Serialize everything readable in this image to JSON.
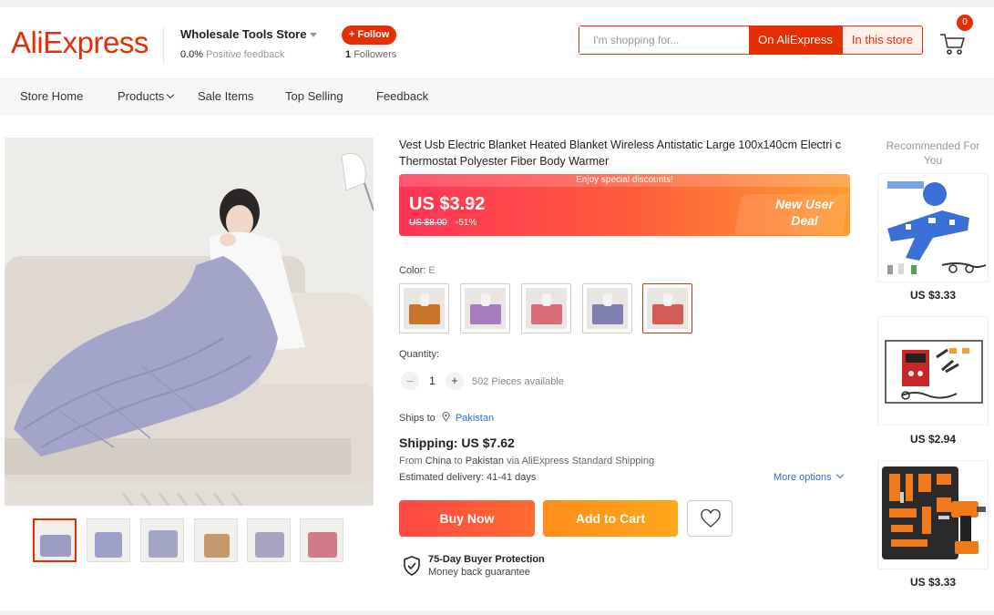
{
  "brand": {
    "logo_text": "AliExpress",
    "accent": "#e62e04"
  },
  "store": {
    "name": "Wholesale Tools Store",
    "feedback_value": "0.0%",
    "feedback_label": "Positive feedback",
    "follow_label": "+ Follow",
    "followers_count": "1",
    "followers_label": "Followers"
  },
  "search": {
    "placeholder": "I'm shopping for...",
    "btn_aliexpress": "On AliExpress",
    "btn_store": "In this store"
  },
  "cart": {
    "count": "0",
    "icon": "cart-icon"
  },
  "nav": {
    "items": [
      {
        "label": "Store Home"
      },
      {
        "label": "Products",
        "dropdown": true
      },
      {
        "label": "Sale Items"
      },
      {
        "label": "Top Selling"
      },
      {
        "label": "Feedback"
      }
    ]
  },
  "product": {
    "title": "Vest Usb Electric Blanket Heated Blanket Wireless Antistatic Large 100x140cm Electri c Thermostat Polyester Fiber Body Warmer",
    "banner_top": "Enjoy special discounts!",
    "price": "US $3.92",
    "original_price": "US $8.00",
    "discount": "-51%",
    "deal_line1": "New User",
    "deal_line2": "Deal",
    "color_label": "Color:",
    "color_value": "E",
    "quantity_label": "Quantity:",
    "quantity": "1",
    "qty_minus": "–",
    "qty_plus": "+",
    "available": "502 Pieces available",
    "ships_to_label": "Ships to",
    "ships_to_country": "Pakistan",
    "shipping": "Shipping: US $7.62",
    "ship_from_pre": "From",
    "ship_from_origin": "China",
    "ship_from_mid": "to",
    "ship_from_dest": "Pakistan",
    "ship_from_post": "via AliExpress Standard Shipping",
    "estimated": "Estimated delivery: 41-41 days",
    "more_options": "More options",
    "buy_now": "Buy Now",
    "add_to_cart": "Add to Cart",
    "protection_title": "75-Day Buyer Protection",
    "protection_sub": "Money back guarantee"
  },
  "swatch_colors": [
    "#c8742b",
    "#a77bc0",
    "#d86c77",
    "#7f7fb0",
    "#d55b55"
  ],
  "thumb_colors": [
    "#9b9cc4",
    "#9ca0c8",
    "#a3a5c6",
    "#c49a6c",
    "#a8a4c2",
    "#d27a86"
  ],
  "recommended": {
    "title": "Recommended For You",
    "items": [
      {
        "price": "US $3.33",
        "icon": "toy-gun-icon"
      },
      {
        "price": "US $2.94",
        "icon": "welder-icon"
      },
      {
        "price": "US $3.33",
        "icon": "toolkit-icon"
      }
    ]
  }
}
